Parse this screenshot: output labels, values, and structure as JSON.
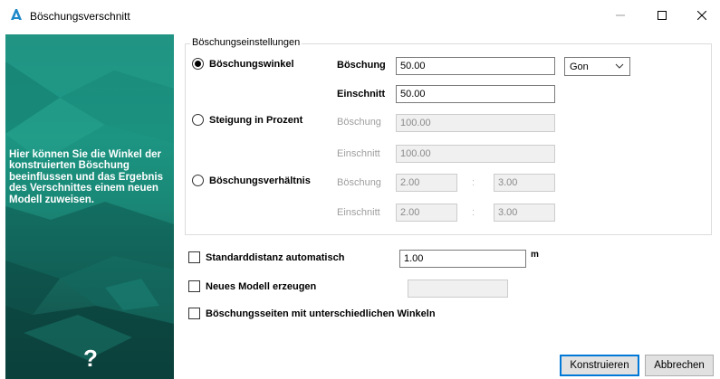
{
  "window": {
    "title": "Böschungsverschnitt",
    "app_icon": "autodesk-a-logo-icon",
    "controls": [
      "minimize-icon",
      "maximize-icon",
      "close-icon"
    ]
  },
  "sidebar": {
    "help_text": "Hier können Sie die Winkel der konstruierten Böschung beeinflussen und das Ergebnis des Verschnittes einem neuen Modell zuweisen.",
    "help_icon_text": "?"
  },
  "settings": {
    "legend": "Böschungseinstellungen",
    "options": [
      {
        "label": "Böschungswinkel",
        "selected": true,
        "boeschung_label": "Böschung",
        "boeschung_value": "50.00",
        "einschnitt_label": "Einschnitt",
        "einschnitt_value": "50.00",
        "unit_select": "Gon"
      },
      {
        "label": "Steigung in Prozent",
        "selected": false,
        "boeschung_label": "Böschung",
        "boeschung_value": "100.00",
        "einschnitt_label": "Einschnitt",
        "einschnitt_value": "100.00"
      },
      {
        "label": "Böschungsverhältnis",
        "selected": false,
        "boeschung_label": "Böschung",
        "boeschung_a": "2.00",
        "boeschung_b": "3.00",
        "einschnitt_label": "Einschnitt",
        "einschnitt_a": "2.00",
        "einschnitt_b": "3.00",
        "separator": ":"
      }
    ]
  },
  "options": {
    "standarddistanz_label": "Standarddistanz automatisch",
    "standarddistanz_value": "1.00",
    "standarddistanz_unit": "m",
    "neues_modell_label": "Neues Modell erzeugen",
    "neues_modell_value": "",
    "seiten_label": "Böschungsseiten mit unterschiedlichen Winkeln"
  },
  "buttons": {
    "konstruieren": "Konstruieren",
    "abbrechen": "Abbrechen"
  },
  "colors": {
    "sidebar_teal": "#1c9582",
    "primary_border": "#0078d7",
    "disabled_text": "#9e9e9e"
  }
}
